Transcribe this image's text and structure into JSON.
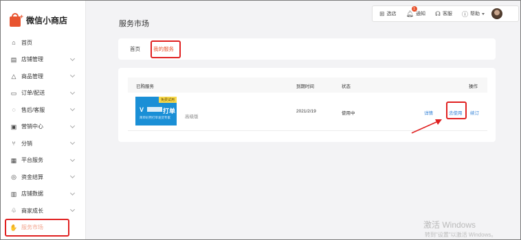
{
  "brand": {
    "name": "微信小商店"
  },
  "sidebar": {
    "items": [
      {
        "label": "首页",
        "icon": "home-icon",
        "glyph": "⌂",
        "has_chevron": false
      },
      {
        "label": "店铺管理",
        "icon": "store-icon",
        "glyph": "▤",
        "has_chevron": true
      },
      {
        "label": "商品管理",
        "icon": "bag-icon",
        "glyph": "△",
        "has_chevron": true
      },
      {
        "label": "订单/配送",
        "icon": "order-icon",
        "glyph": "▭",
        "has_chevron": true
      },
      {
        "label": "售后/客服",
        "icon": "headset-icon",
        "glyph": "◌",
        "has_chevron": true
      },
      {
        "label": "营销中心",
        "icon": "marketing-icon",
        "glyph": "▣",
        "has_chevron": true
      },
      {
        "label": "分销",
        "icon": "share-icon",
        "glyph": "⑂",
        "has_chevron": true
      },
      {
        "label": "平台服务",
        "icon": "platform-icon",
        "glyph": "▦",
        "has_chevron": true
      },
      {
        "label": "资金结算",
        "icon": "money-icon",
        "glyph": "◎",
        "has_chevron": true
      },
      {
        "label": "店铺数据",
        "icon": "data-icon",
        "glyph": "▥",
        "has_chevron": true
      },
      {
        "label": "商家成长",
        "icon": "growth-icon",
        "glyph": "♧",
        "has_chevron": true
      },
      {
        "label": "服务市场",
        "icon": "market-icon",
        "glyph": "✋",
        "has_chevron": false,
        "active": true
      }
    ]
  },
  "topbar": {
    "items": [
      {
        "label": "选店",
        "icon": "switch-store-icon",
        "glyph": "⊞"
      },
      {
        "label": "通知",
        "icon": "bell-icon",
        "glyph": "♫",
        "badge": "1"
      },
      {
        "label": "客服",
        "icon": "headset-icon",
        "glyph": "♎"
      },
      {
        "label": "帮助",
        "icon": "help-icon",
        "glyph": "?"
      }
    ]
  },
  "page": {
    "title": "服务市场"
  },
  "tabs": [
    {
      "label": "首页"
    },
    {
      "label": "我的服务",
      "active": true
    }
  ],
  "table": {
    "headers": [
      "已购服务",
      "到期时间",
      "状态",
      "操作"
    ],
    "rows": [
      {
        "thumb_tag": "免费试用",
        "thumb_logo": "打单",
        "thumb_sub": "简单好用打单发货专家",
        "edition": "高级版",
        "expiry": "2021/2/19",
        "status": "使用中",
        "actions": [
          "详情",
          "去使用",
          "续订"
        ]
      }
    ]
  },
  "watermark": {
    "title": "激活 Windows",
    "subtitle": "转到\"设置\"以激活 Windows。"
  },
  "colors": {
    "accent": "#e8542f",
    "link": "#2f7fd6",
    "annotation": "#e02020"
  }
}
